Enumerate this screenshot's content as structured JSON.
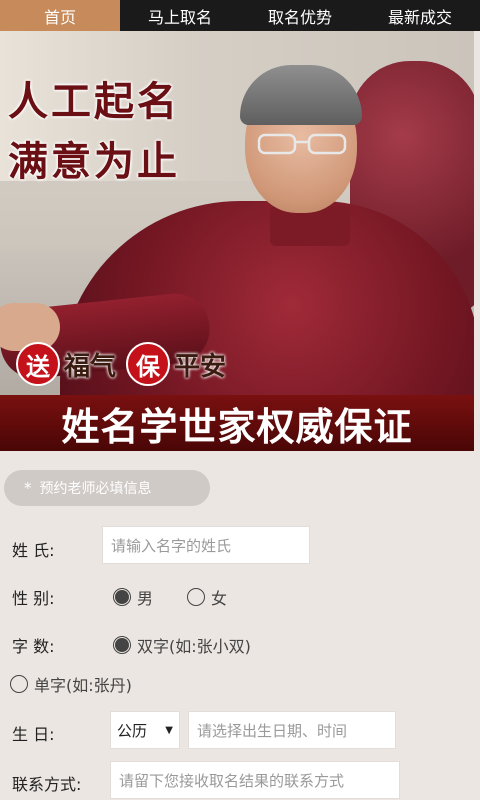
{
  "nav": {
    "tabs": [
      {
        "label": "首页",
        "active": true
      },
      {
        "label": "马上取名",
        "active": false
      },
      {
        "label": "取名优势",
        "active": false
      },
      {
        "label": "最新成交",
        "active": false
      }
    ]
  },
  "hero": {
    "slogan_line1": "人工起名",
    "slogan_line2": "满意为止",
    "gift1_circle": "送",
    "gift1_text": "福气",
    "gift2_circle": "保",
    "gift2_text": "平安",
    "banner": "姓名学世家权威保证"
  },
  "form": {
    "notice": "预约老师必填信息",
    "notice_icon": "*",
    "surname": {
      "label": "姓  氏:",
      "placeholder": "请输入名字的姓氏"
    },
    "gender": {
      "label": "性  别:",
      "options": [
        "男",
        "女"
      ],
      "selected": "男"
    },
    "name_length": {
      "label": "字  数:",
      "options": [
        "双字(如:张小双)",
        "单字(如:张丹)"
      ],
      "selected": "双字(如:张小双)"
    },
    "birthday": {
      "label": "生  日:",
      "calendar_value": "公历",
      "placeholder": "请选择出生日期、时间"
    },
    "contact": {
      "label": "联系方式:",
      "placeholder": "请留下您接收取名结果的联系方式"
    }
  },
  "colors": {
    "nav_bg": "#1a1a1a",
    "nav_active": "#c78a5a",
    "banner_red": "#6a0d0d",
    "gift_red": "#c5121a",
    "page_bg": "#ebe6e2"
  }
}
